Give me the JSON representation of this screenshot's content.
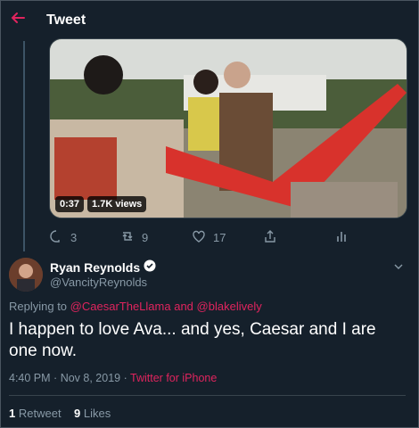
{
  "header": {
    "back_icon": "arrow-left-icon",
    "title": "Tweet"
  },
  "video": {
    "time": "0:37",
    "views": "1.7K views"
  },
  "actions": {
    "replies": "3",
    "retweets": "9",
    "likes": "17"
  },
  "author": {
    "name": "Ryan Reynolds",
    "handle": "@VancityReynolds",
    "verified_icon": "verified-badge-icon"
  },
  "replying": {
    "prefix": "Replying to",
    "mention1": "@CaesarTheLlama",
    "joiner": "and",
    "mention2": "@blakelively"
  },
  "tweet": {
    "text": "I happen to love Ava... and yes, Caesar and I are one now."
  },
  "meta": {
    "time": "4:40 PM",
    "sep1": "·",
    "date": "Nov 8, 2019",
    "sep2": "·",
    "source": "Twitter for iPhone"
  },
  "stats": {
    "retweets_count": "1",
    "retweets_label": "Retweet",
    "likes_count": "9",
    "likes_label": "Likes"
  },
  "colors": {
    "background": "#15202b",
    "accent": "#e0245e",
    "muted": "#8899a6"
  }
}
